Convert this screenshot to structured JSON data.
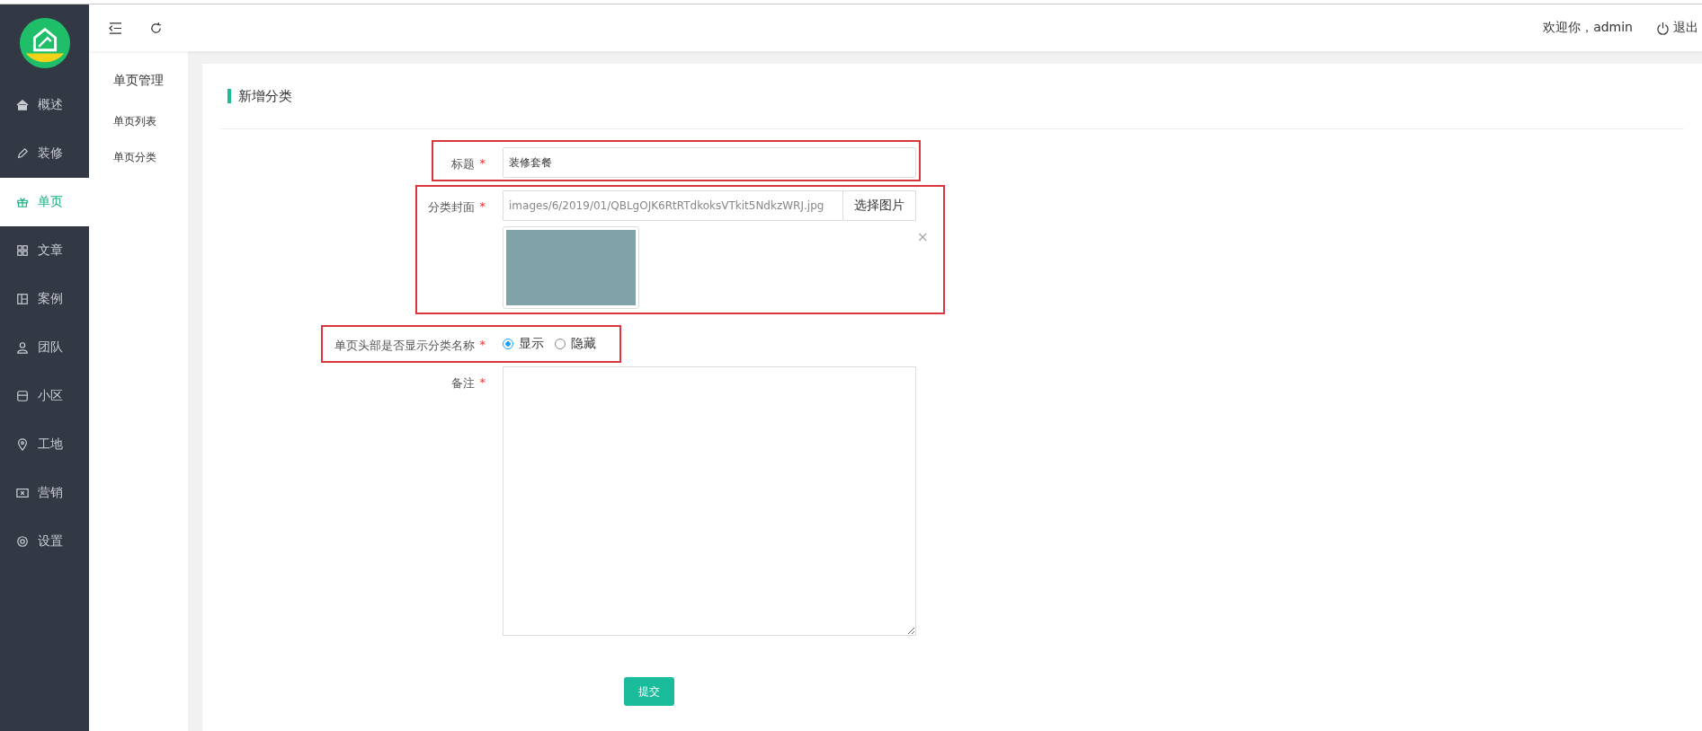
{
  "sidebar": {
    "items": [
      {
        "label": "概述",
        "kind": "home",
        "selected": false
      },
      {
        "label": "装修",
        "kind": "pencil",
        "selected": false
      },
      {
        "label": "单页",
        "kind": "gift",
        "selected": true
      },
      {
        "label": "文章",
        "kind": "grid",
        "selected": false
      },
      {
        "label": "案例",
        "kind": "layout",
        "selected": false
      },
      {
        "label": "团队",
        "kind": "user",
        "selected": false
      },
      {
        "label": "小区",
        "kind": "store",
        "selected": false
      },
      {
        "label": "工地",
        "kind": "pin",
        "selected": false
      },
      {
        "label": "营销",
        "kind": "ticket",
        "selected": false
      },
      {
        "label": "设置",
        "kind": "gear",
        "selected": false
      }
    ]
  },
  "submenu": {
    "title": "单页管理",
    "items": [
      "单页列表",
      "单页分类"
    ]
  },
  "header": {
    "welcome": "欢迎你，admin",
    "logout": "退出"
  },
  "form": {
    "title": "新增分类",
    "fields": [
      {
        "kind": "text",
        "label": "标题",
        "required_mark": "*",
        "value": "装修套餐"
      },
      {
        "kind": "image",
        "label": "分类封面",
        "required_mark": "*",
        "value": "images/6/2019/01/QBLgOJK6RtRTdkoksVTkit5NdkzWRJ.jpg",
        "button": "选择图片",
        "remove": "×"
      },
      {
        "kind": "radio",
        "label": "单页头部是否显示分类名称",
        "required_mark": "*",
        "options": [
          {
            "label": "显示",
            "selected": true
          },
          {
            "label": "隐藏",
            "selected": false
          }
        ]
      },
      {
        "kind": "textarea",
        "label": "备注",
        "required_mark": "*"
      }
    ],
    "submit": "提交"
  }
}
